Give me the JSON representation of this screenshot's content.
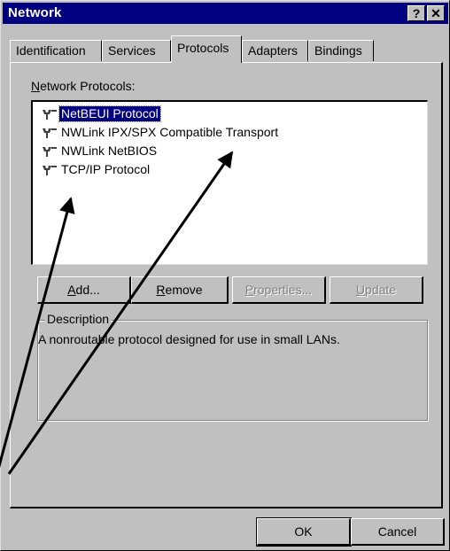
{
  "window": {
    "title": "Network",
    "help_glyph": "?",
    "close_glyph": "✕"
  },
  "tabs": [
    {
      "label": "Identification"
    },
    {
      "label": "Services"
    },
    {
      "label": "Protocols",
      "active": true
    },
    {
      "label": "Adapters"
    },
    {
      "label": "Bindings"
    }
  ],
  "protocols": {
    "label_accel": "N",
    "label_rest": "etwork Protocols:",
    "items": [
      {
        "label": "NetBEUI Protocol",
        "selected": true,
        "icon": "network-protocol-icon"
      },
      {
        "label": "NWLink IPX/SPX Compatible Transport",
        "icon": "network-protocol-icon"
      },
      {
        "label": "NWLink NetBIOS",
        "icon": "network-protocol-icon"
      },
      {
        "label": "TCP/IP Protocol",
        "icon": "network-protocol-icon"
      }
    ]
  },
  "buttons": {
    "add_accel": "A",
    "add_rest": "dd...",
    "remove_accel": "R",
    "remove_rest": "emove",
    "properties_accel": "P",
    "properties_rest": "roperties...",
    "update_accel": "U",
    "update_rest": "pdate"
  },
  "description": {
    "legend": "Description",
    "text": "A nonroutable protocol designed for use in small LANs."
  },
  "footer": {
    "ok": "OK",
    "cancel": "Cancel"
  },
  "colors": {
    "title_bar": "#000080",
    "selection": "#000080",
    "face": "#c0c0c0"
  }
}
